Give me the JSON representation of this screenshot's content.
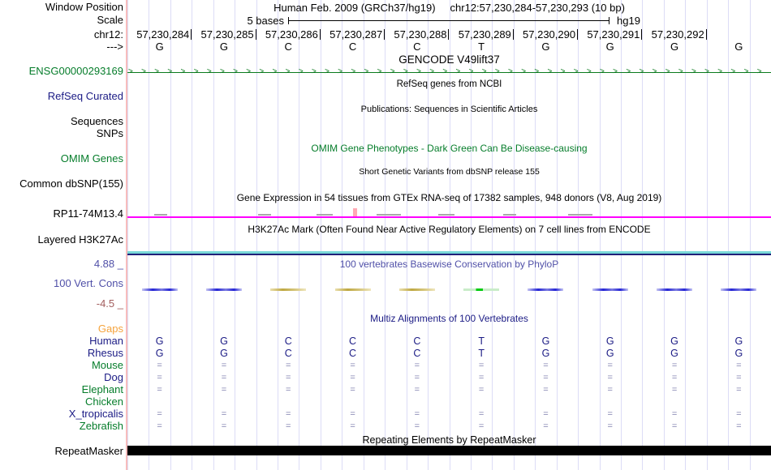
{
  "header": {
    "window_position_label": "Window Position",
    "assembly": "Human Feb. 2009 (GRCh37/hg19)",
    "position": "chr12:57,230,284-57,230,293 (10 bp)",
    "scale_label": "Scale",
    "scale_text": "5 bases",
    "scale_assembly": "hg19",
    "chrom_label": "chr12:",
    "strand_label": "--->"
  },
  "ruler": {
    "positions": [
      "57,230,284",
      "57,230,285",
      "57,230,286",
      "57,230,287",
      "57,230,288",
      "57,230,289",
      "57,230,290",
      "57,230,291",
      "57,230,292"
    ],
    "bases": [
      "G",
      "G",
      "C",
      "C",
      "C",
      "T",
      "G",
      "G",
      "G",
      "G"
    ]
  },
  "tracks": {
    "gencode": {
      "title": "GENCODE V49lift37",
      "gene": "ENSG00000293169"
    },
    "refseq": {
      "title": "RefSeq genes from NCBI",
      "label": "RefSeq Curated"
    },
    "publications": {
      "title": "Publications: Sequences in Scientific Articles",
      "label_sequences": "Sequences",
      "label_snps": "SNPs"
    },
    "omim": {
      "title": "OMIM Gene Phenotypes - Dark Green Can Be Disease-causing",
      "label": "OMIM Genes"
    },
    "dbsnp": {
      "title": "Short Genetic Variants from dbSNP release 155",
      "label": "Common dbSNP(155)"
    },
    "gtex": {
      "title": "Gene Expression in 54 tissues from GTEx RNA-seq of 17382 samples, 948 donors (V8, Aug 2019)",
      "label": "RP11-74M13.4"
    },
    "h3k27ac": {
      "title": "H3K27Ac Mark (Often Found Near Active Regulatory Elements) on 7 cell lines from ENCODE",
      "label": "Layered H3K27Ac"
    },
    "phylop": {
      "title": "100 vertebrates Basewise Conservation by PhyloP",
      "label": "100 Vert. Cons",
      "ymax": "4.88 _",
      "ymin": "-4.5 _",
      "dash_colors": [
        "blue",
        "blue",
        "olive",
        "olive",
        "olive",
        "green",
        "blue",
        "blue",
        "blue",
        "blue"
      ]
    },
    "multiz": {
      "title": "Multiz Alignments of 100 Vertebrates",
      "gaps_label": "Gaps",
      "rows": [
        {
          "name": "Human",
          "color": "navy",
          "cells": [
            "G",
            "G",
            "C",
            "C",
            "C",
            "T",
            "G",
            "G",
            "G",
            "G"
          ]
        },
        {
          "name": "Rhesus",
          "color": "navy",
          "cells": [
            "G",
            "G",
            "C",
            "C",
            "C",
            "T",
            "G",
            "G",
            "G",
            "G"
          ]
        },
        {
          "name": "Mouse",
          "color": "green",
          "cells": [
            "=",
            "=",
            "=",
            "=",
            "=",
            "=",
            "=",
            "=",
            "=",
            "="
          ]
        },
        {
          "name": "Dog",
          "color": "navy",
          "cells": [
            "=",
            "=",
            "=",
            "=",
            "=",
            "=",
            "=",
            "=",
            "=",
            "="
          ]
        },
        {
          "name": "Elephant",
          "color": "green",
          "cells": [
            "=",
            "=",
            "=",
            "=",
            "=",
            "=",
            "=",
            "=",
            "=",
            "="
          ]
        },
        {
          "name": "Chicken",
          "color": "green",
          "cells": []
        },
        {
          "name": "X_tropicalis",
          "color": "navy",
          "cells": [
            "=",
            "=",
            "=",
            "=",
            "=",
            "=",
            "=",
            "=",
            "=",
            "="
          ]
        },
        {
          "name": "Zebrafish",
          "color": "green",
          "cells": [
            "=",
            "=",
            "=",
            "=",
            "=",
            "=",
            "=",
            "=",
            "=",
            "="
          ]
        }
      ]
    },
    "repeatmasker": {
      "title": "Repeating Elements by RepeatMasker",
      "label": "RepeatMasker"
    }
  },
  "colors": {
    "grid": "#dcdcf6",
    "separator": "#f8bcbc",
    "gene_green": "#0b7a1e",
    "gtex_magenta": "#ff00ff",
    "gtex_pink_tick": "#ffaab4",
    "h3k27ac_cyan": "#78d8d8",
    "h3k27ac_navy": "#20207a",
    "phylop_blue": "#2525d6",
    "phylop_olive": "#bfa843",
    "phylop_green": "#00cc11",
    "text_navy": "#1b1b85",
    "text_green": "#067d2b",
    "text_blue": "#5050a8",
    "text_brown": "#a25d5d",
    "text_orange": "#f5a33c",
    "repeat_bar": "#000000"
  }
}
